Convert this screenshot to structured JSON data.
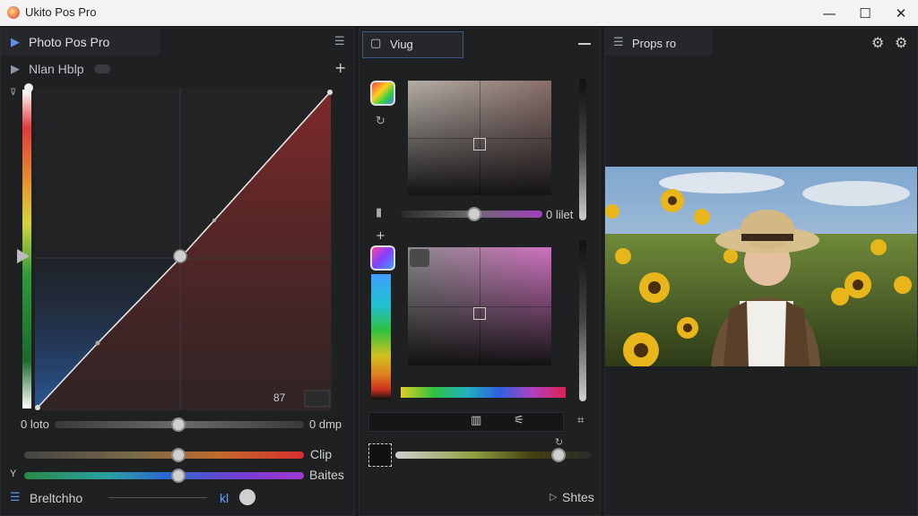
{
  "window": {
    "title": "Ukito Pos Pro",
    "minimize": "—",
    "maximize": "☐",
    "close": "✕"
  },
  "left_panel": {
    "tab_title": "Photo Pos Pro",
    "sub_title": "Nlan Hblp",
    "curve_corner": "87",
    "slider1": {
      "left_label": "0 loto",
      "right_label": "0 dmp",
      "value": 0.5
    },
    "slider2": {
      "right_label": "Clip",
      "value": 0.5
    },
    "slider3": {
      "left_label": "Y",
      "right_label": "Baites",
      "value": 0.5
    },
    "bottom_label": "Breltchho",
    "bottom_tag": "kl"
  },
  "middle_panel": {
    "tab_title": "Viug",
    "slider_label": "0 lilet",
    "slider_value": 0.55,
    "bottom_label": "Shtes",
    "bottom_slider_value": 0.9
  },
  "right_panel": {
    "tab_title": "Props ro"
  }
}
